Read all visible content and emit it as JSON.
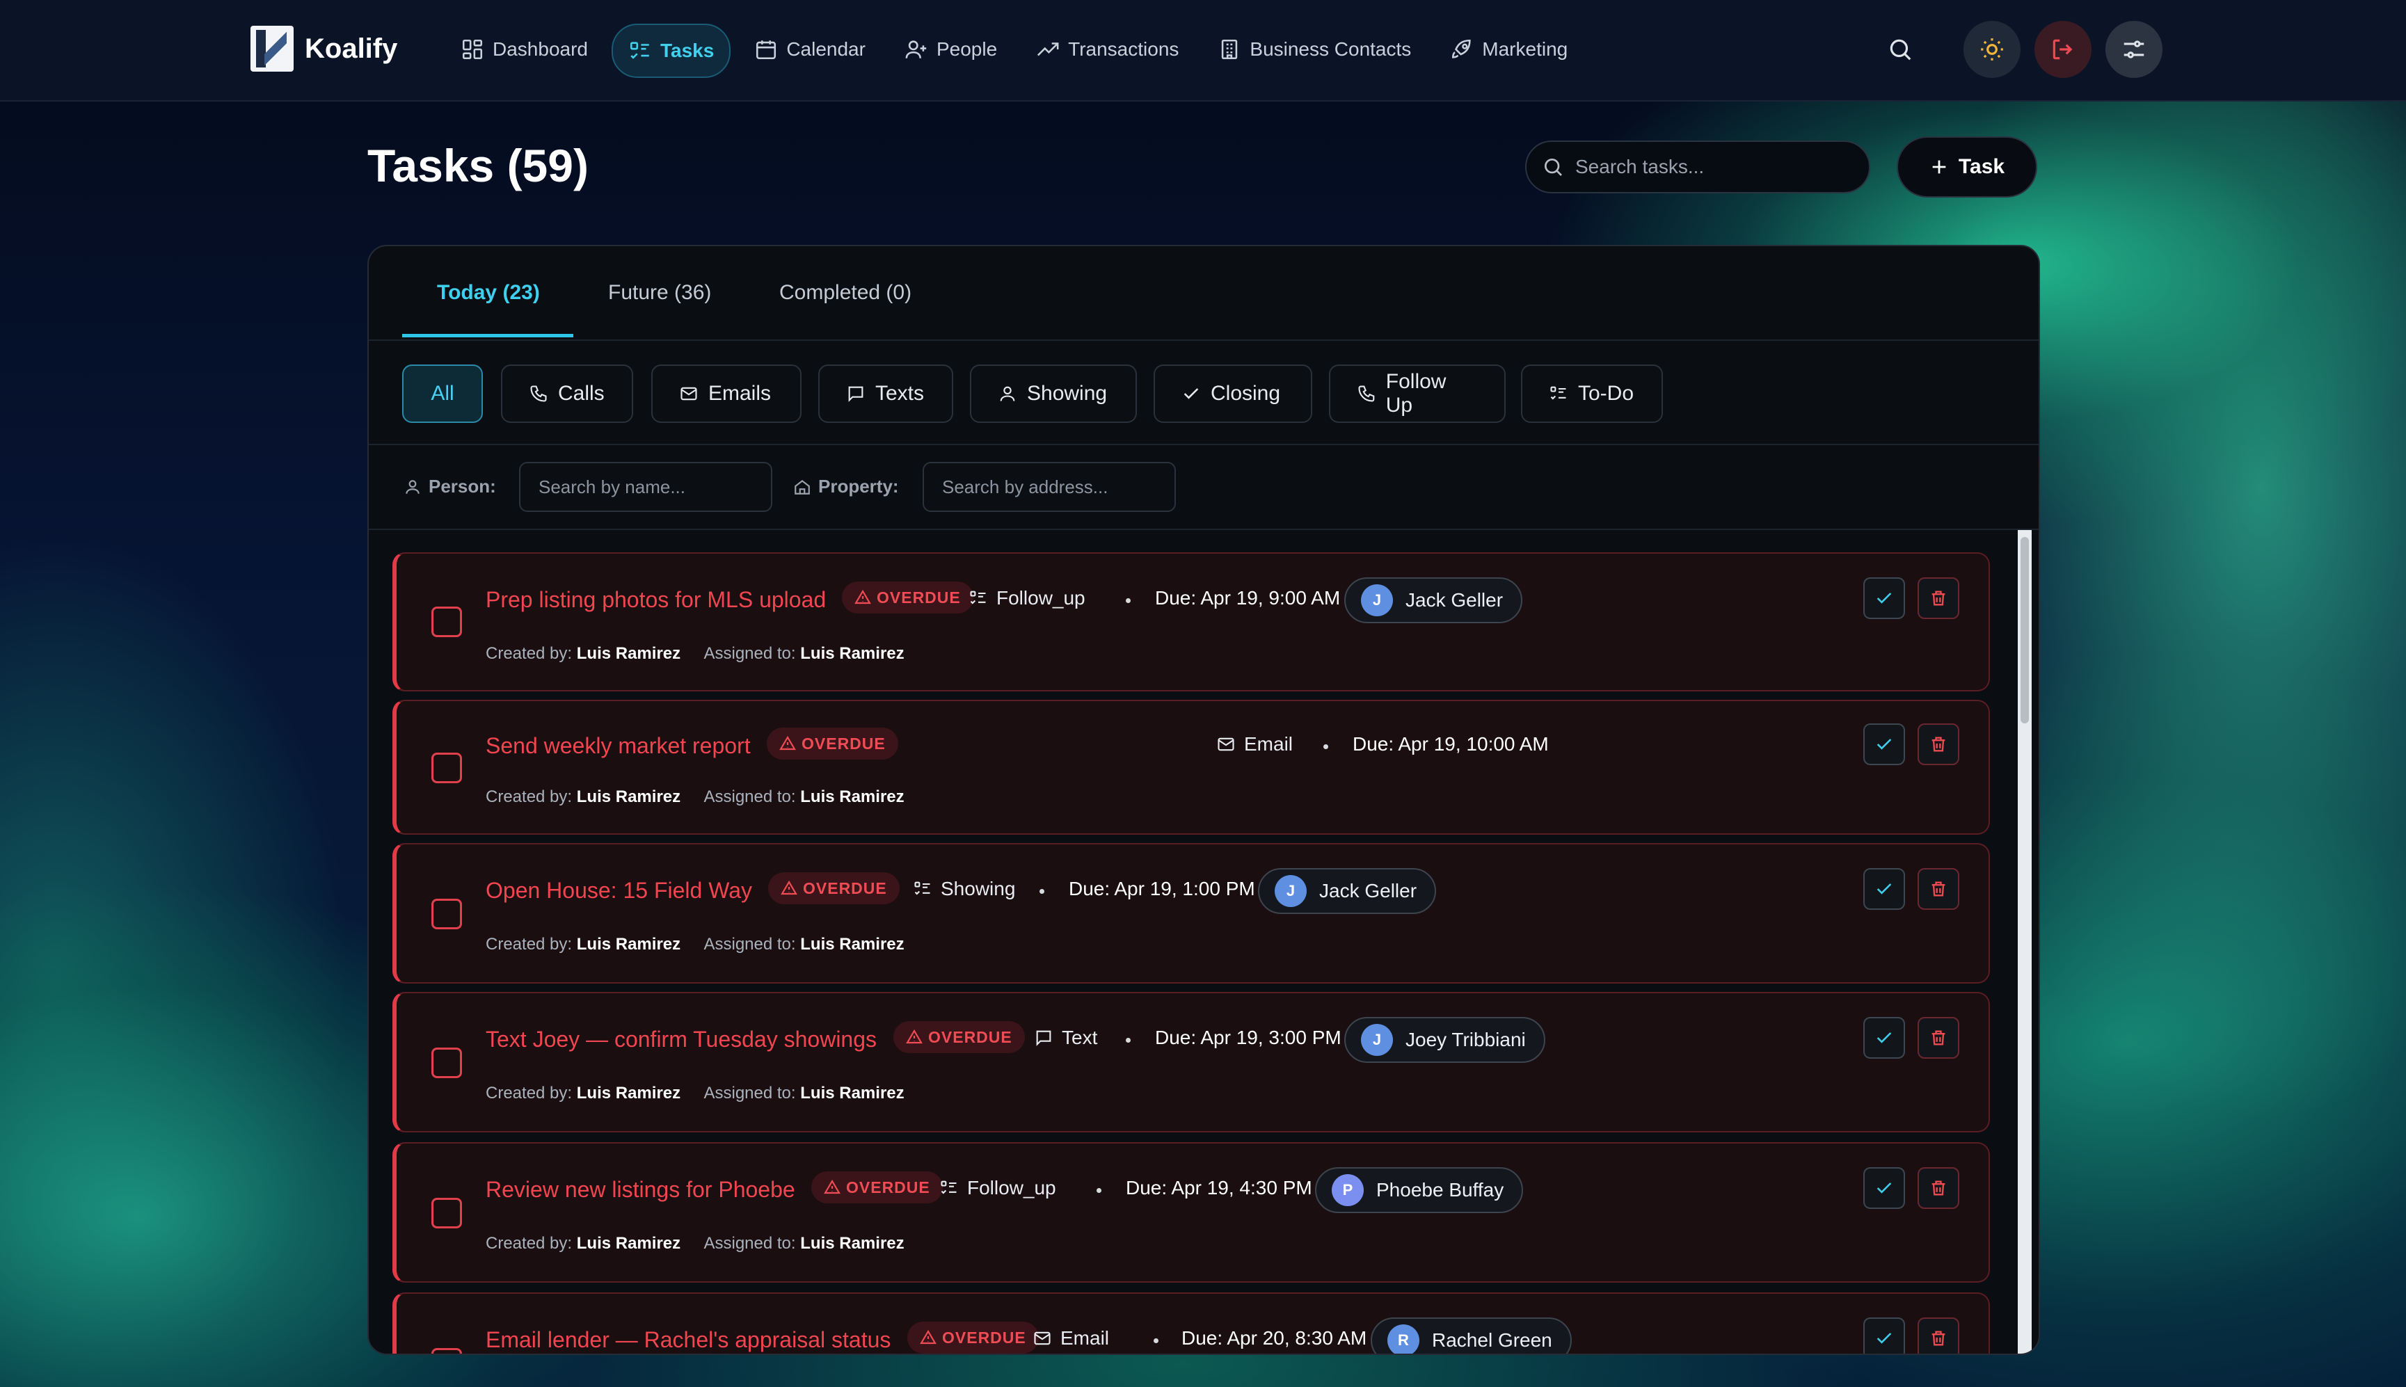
{
  "app": {
    "name": "Koalify"
  },
  "nav": {
    "items": [
      {
        "label": "Dashboard",
        "icon": "dashboard-icon"
      },
      {
        "label": "Tasks",
        "icon": "tasks-icon"
      },
      {
        "label": "Calendar",
        "icon": "calendar-icon"
      },
      {
        "label": "People",
        "icon": "people-icon"
      },
      {
        "label": "Transactions",
        "icon": "transactions-icon"
      },
      {
        "label": "Business Contacts",
        "icon": "building-icon"
      },
      {
        "label": "Marketing",
        "icon": "rocket-icon"
      }
    ],
    "active": "Tasks"
  },
  "page": {
    "title": "Tasks (59)",
    "search_placeholder": "Search tasks...",
    "add_label": "Task"
  },
  "tabs": [
    {
      "label": "Today (23)"
    },
    {
      "label": "Future (36)"
    },
    {
      "label": "Completed (0)"
    }
  ],
  "filters": [
    {
      "label": "All"
    },
    {
      "label": "Calls"
    },
    {
      "label": "Emails"
    },
    {
      "label": "Texts"
    },
    {
      "label": "Showing"
    },
    {
      "label": "Closing"
    },
    {
      "label": "Follow Up"
    },
    {
      "label": "To-Do"
    }
  ],
  "search_row": {
    "person_label": "Person:",
    "person_placeholder": "Search by name...",
    "property_label": "Property:",
    "property_placeholder": "Search by address..."
  },
  "task_labels": {
    "overdue": "OVERDUE",
    "created_by": "Created by:",
    "assigned_to": "Assigned to:"
  },
  "tasks": [
    {
      "title": "Prep listing photos for MLS upload",
      "type": "Follow_up",
      "due": "Due: Apr 19, 9:00 AM",
      "person": "Jack Geller",
      "initial": "J",
      "created_by": "Luis Ramirez",
      "assigned_to": "Luis Ramirez"
    },
    {
      "title": "Send weekly market report",
      "type": "Email",
      "due": "Due: Apr 19, 10:00 AM",
      "person": "",
      "initial": "",
      "created_by": "Luis Ramirez",
      "assigned_to": "Luis Ramirez"
    },
    {
      "title": "Open House: 15 Field Way",
      "type": "Showing",
      "due": "Due: Apr 19, 1:00 PM",
      "person": "Jack Geller",
      "initial": "J",
      "created_by": "Luis Ramirez",
      "assigned_to": "Luis Ramirez"
    },
    {
      "title": "Text Joey — confirm Tuesday showings",
      "type": "Text",
      "due": "Due: Apr 19, 3:00 PM",
      "person": "Joey Tribbiani",
      "initial": "J",
      "created_by": "Luis Ramirez",
      "assigned_to": "Luis Ramirez"
    },
    {
      "title": "Review new listings for Phoebe",
      "type": "Follow_up",
      "due": "Due: Apr 19, 4:30 PM",
      "person": "Phoebe Buffay",
      "initial": "P",
      "created_by": "Luis Ramirez",
      "assigned_to": "Luis Ramirez"
    },
    {
      "title": "Email lender — Rachel's appraisal status",
      "type": "Email",
      "due": "Due: Apr 20, 8:30 AM",
      "person": "Rachel Green",
      "initial": "R",
      "created_by": "Luis Ramirez",
      "assigned_to": "Luis Ramirez"
    }
  ],
  "colors": {
    "accent": "#3fcfef",
    "overdue": "#f1454f",
    "avatar": "#5e8fe0"
  }
}
